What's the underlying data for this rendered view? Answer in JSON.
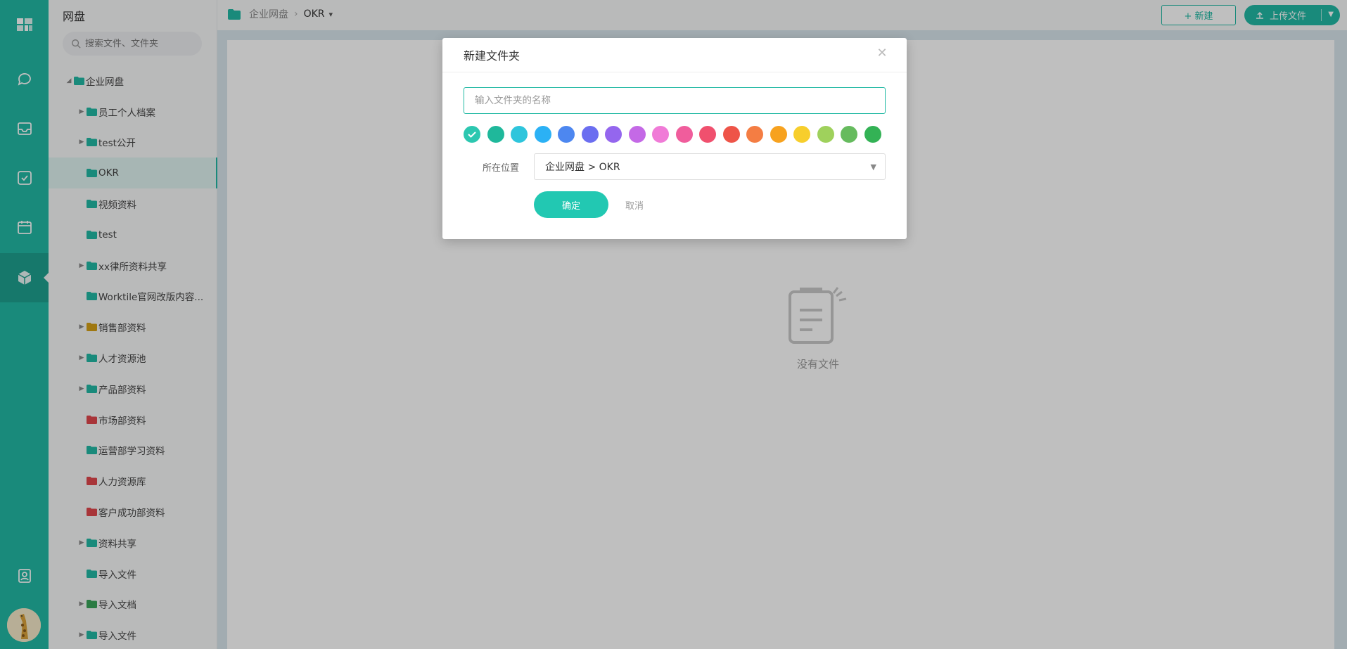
{
  "rail": {
    "icons": [
      "apps-icon",
      "chat-icon",
      "inbox-icon",
      "task-icon",
      "calendar-icon",
      "drive-icon",
      "contacts-icon"
    ]
  },
  "tree": {
    "title": "网盘",
    "search_placeholder": "搜索文件、文件夹",
    "root_label": "企业网盘",
    "items": [
      {
        "label": "员工个人档案",
        "color": "#22b9a4",
        "expandable": true
      },
      {
        "label": "test公开",
        "color": "#22b9a4",
        "expandable": true
      },
      {
        "label": "OKR",
        "color": "#22b9a4",
        "expandable": false,
        "selected": true
      },
      {
        "label": "视频资料",
        "color": "#22b9a4",
        "expandable": false
      },
      {
        "label": "test",
        "color": "#22b9a4",
        "expandable": false
      },
      {
        "label": "xx律所资料共享",
        "color": "#22b9a4",
        "expandable": true
      },
      {
        "label": "Worktile官网改版内容...",
        "color": "#22b9a4",
        "expandable": false
      },
      {
        "label": "销售部资料",
        "color": "#d4a017",
        "expandable": true
      },
      {
        "label": "人才资源池",
        "color": "#22b9a4",
        "expandable": true
      },
      {
        "label": "产品部资料",
        "color": "#22b9a4",
        "expandable": true
      },
      {
        "label": "市场部资料",
        "color": "#e0474c",
        "expandable": false
      },
      {
        "label": "运营部学习资料",
        "color": "#22b9a4",
        "expandable": false
      },
      {
        "label": "人力资源库",
        "color": "#e0474c",
        "expandable": false
      },
      {
        "label": "客户成功部资料",
        "color": "#e0474c",
        "expandable": false
      },
      {
        "label": "资料共享",
        "color": "#22b9a4",
        "expandable": true
      },
      {
        "label": "导入文件",
        "color": "#22b9a4",
        "expandable": false
      },
      {
        "label": "导入文档",
        "color": "#3aa55a",
        "expandable": true
      },
      {
        "label": "导入文件",
        "color": "#22b9a4",
        "expandable": true
      }
    ]
  },
  "header": {
    "breadcrumb_root": "企业网盘",
    "breadcrumb_sep": "›",
    "breadcrumb_current": "OKR",
    "new_button": "+ 新建",
    "upload_button": "上传文件"
  },
  "main": {
    "empty_text": "没有文件"
  },
  "modal": {
    "title": "新建文件夹",
    "name_placeholder": "输入文件夹的名称",
    "colors": [
      "#2cc7b0",
      "#1fb89b",
      "#2ec5dc",
      "#2bb1f5",
      "#4d87f0",
      "#6b6ef0",
      "#9466ee",
      "#c469e6",
      "#f07bd7",
      "#f05d9c",
      "#f0506e",
      "#ee5448",
      "#f47d43",
      "#f7a21f",
      "#f7ce2c",
      "#9fd15c",
      "#66bb5e",
      "#33b255"
    ],
    "selected_color_index": 0,
    "location_label": "所在位置",
    "location_value": "企业网盘 > OKR",
    "ok_label": "确定",
    "cancel_label": "取消"
  }
}
